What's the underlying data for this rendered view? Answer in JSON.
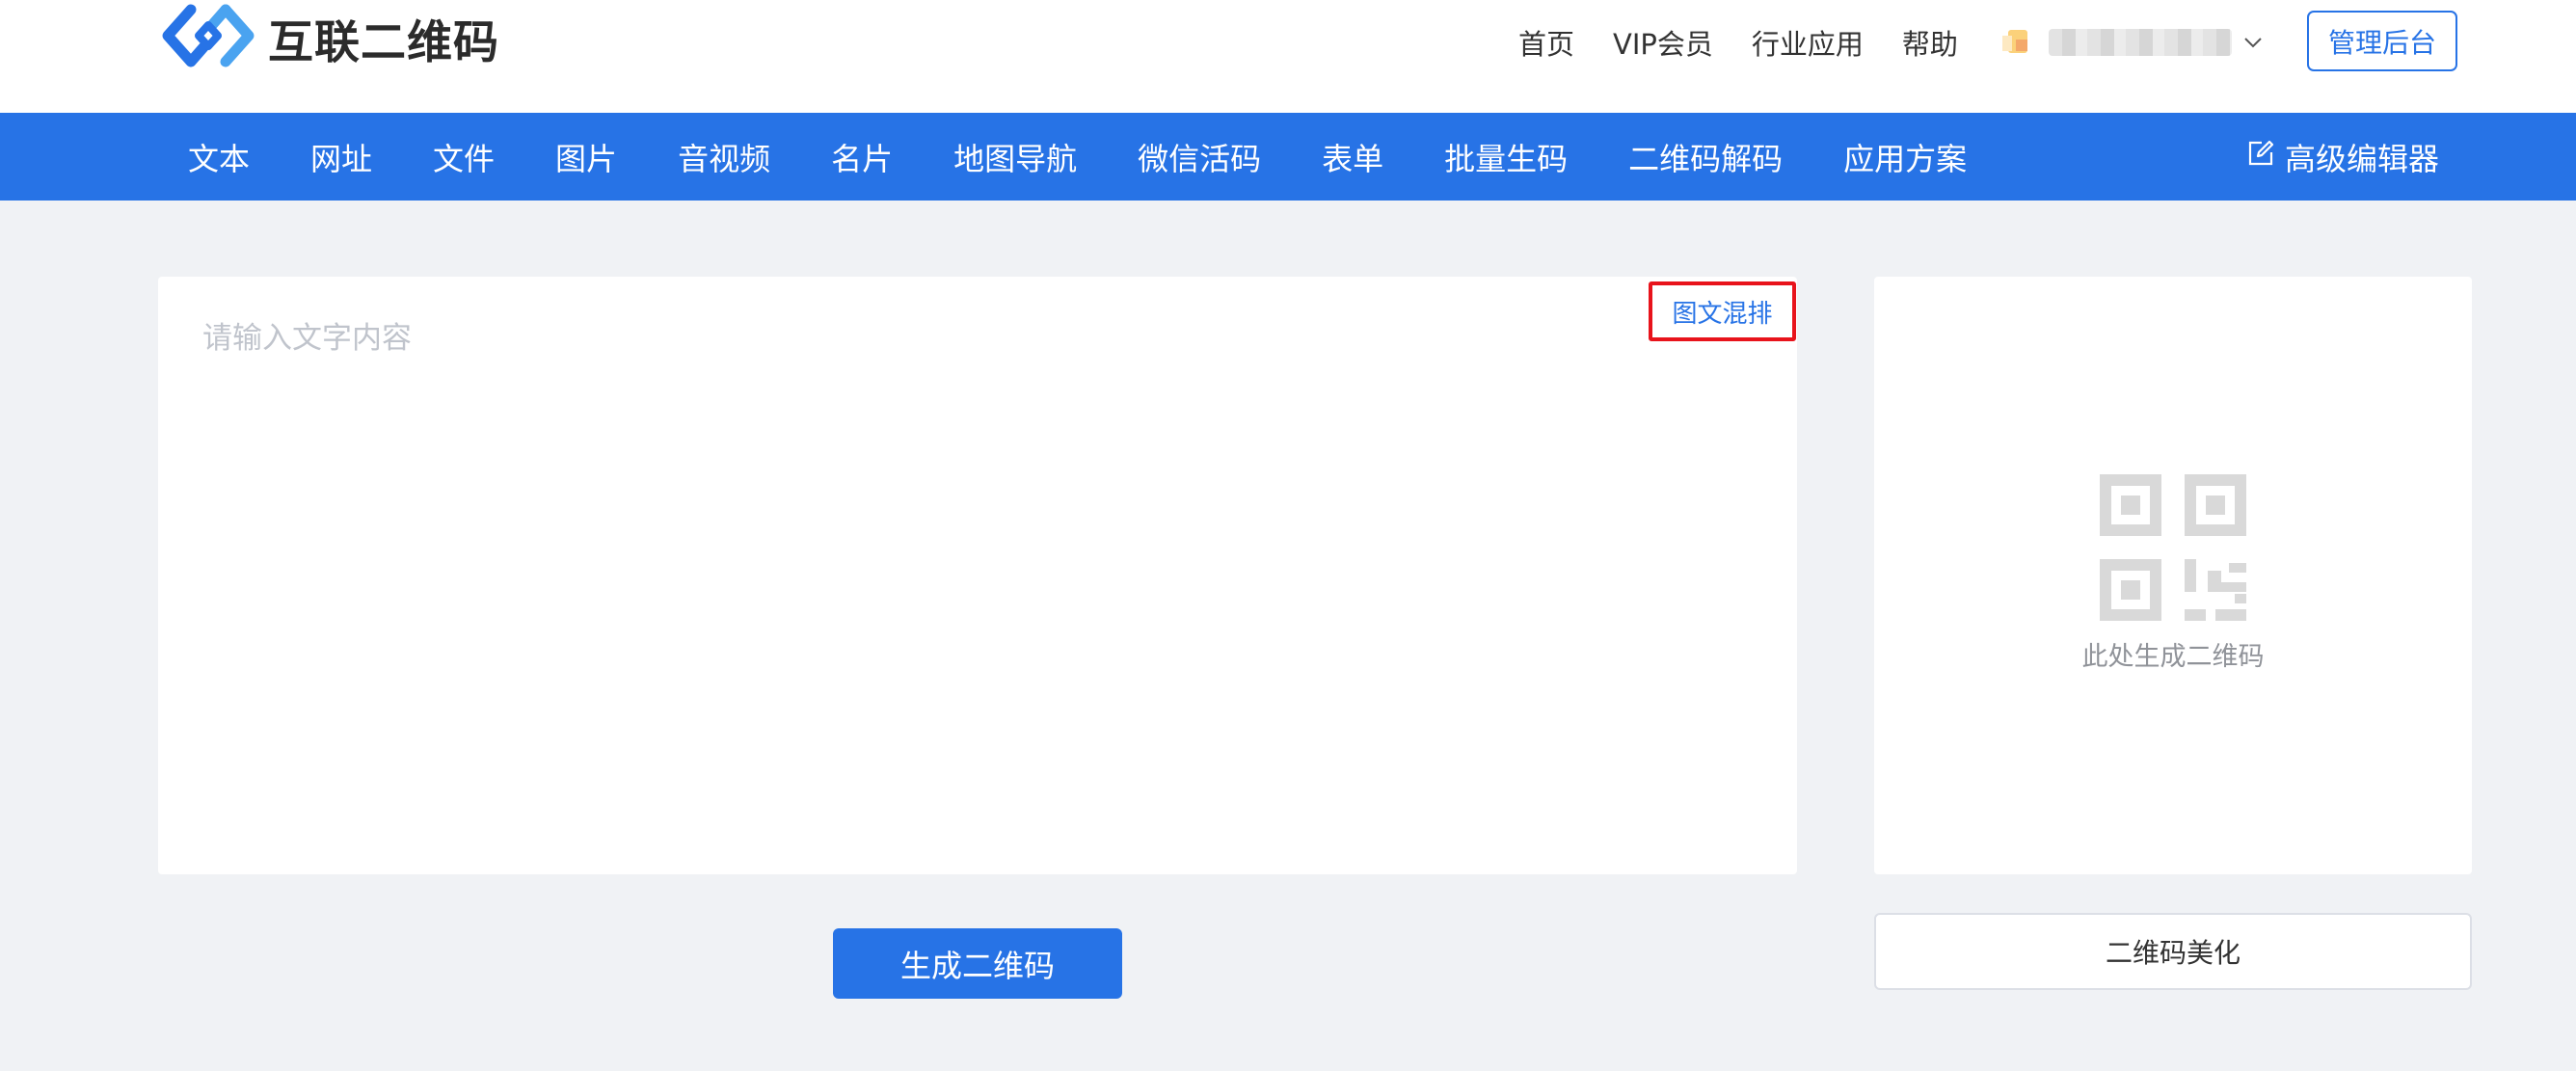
{
  "header": {
    "logo_text": "互联二维码",
    "nav": [
      {
        "label": "首页"
      },
      {
        "label": "VIP会员"
      },
      {
        "label": "行业应用"
      },
      {
        "label": "帮助"
      }
    ],
    "admin_label": "管理后台"
  },
  "tabs": [
    {
      "label": "文本"
    },
    {
      "label": "网址"
    },
    {
      "label": "文件"
    },
    {
      "label": "图片"
    },
    {
      "label": "音视频"
    },
    {
      "label": "名片"
    },
    {
      "label": "地图导航"
    },
    {
      "label": "微信活码"
    },
    {
      "label": "表单"
    },
    {
      "label": "批量生码"
    },
    {
      "label": "二维码解码"
    },
    {
      "label": "应用方案"
    }
  ],
  "advanced_editor_label": "高级编辑器",
  "editor": {
    "placeholder": "请输入文字内容",
    "mix_label": "图文混排",
    "generate_label": "生成二维码"
  },
  "preview": {
    "placeholder_text": "此处生成二维码",
    "beautify_label": "二维码美化"
  },
  "colors": {
    "primary": "#2773e6",
    "highlight": "#e8131b",
    "background": "#f0f2f5"
  },
  "icons": {
    "logo": "logo-icon",
    "user_dropdown": "chevron-down-icon",
    "advanced_editor": "edit-icon",
    "qr_placeholder": "qrcode-icon"
  }
}
